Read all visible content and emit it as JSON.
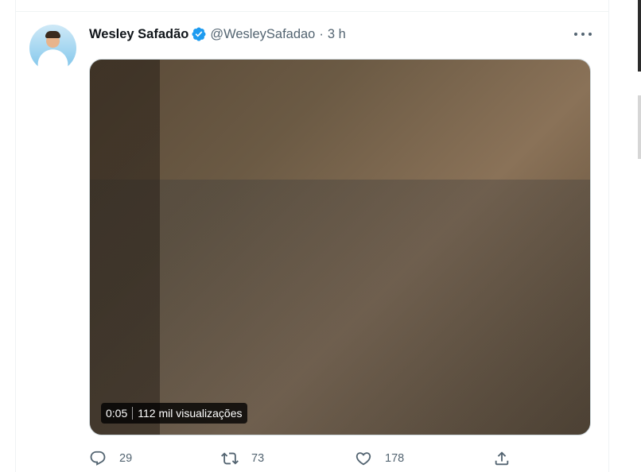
{
  "tweet": {
    "display_name": "Wesley Safadão",
    "handle": "@WesleySafadao",
    "separator": "·",
    "time": "3 h",
    "verified": true
  },
  "media": {
    "duration": "0:05",
    "views": "112 mil visualizações"
  },
  "actions": {
    "replies": "29",
    "retweets": "73",
    "likes": "178"
  },
  "colors": {
    "verified": "#1d9bf0",
    "text_primary": "#0f1419",
    "text_secondary": "#536471"
  },
  "icons": [
    "verified-badge-icon",
    "more-options-icon",
    "reply-icon",
    "retweet-icon",
    "like-icon",
    "share-icon"
  ]
}
